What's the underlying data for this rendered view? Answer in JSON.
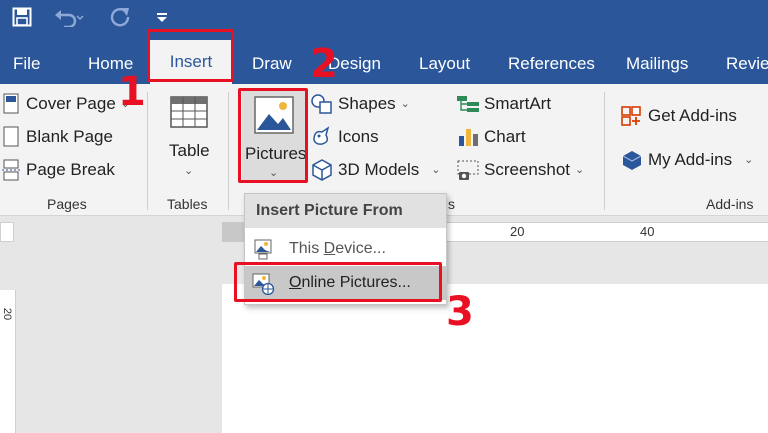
{
  "colors": {
    "title_bar": "#2b579a",
    "ribbon_bg": "#f3f3f3",
    "highlight": "#e81123",
    "menu_hover": "#c8c8c8"
  },
  "quick_access": {
    "save_icon": "save-icon",
    "undo_icon": "undo-icon",
    "redo_icon": "redo-icon",
    "customize_icon": "customize-qat-icon"
  },
  "tabs": {
    "file": "File",
    "home": "Home",
    "insert": "Insert",
    "draw": "Draw",
    "design": "Design",
    "layout": "Layout",
    "references": "References",
    "mailings": "Mailings",
    "review": "Revie"
  },
  "ribbon": {
    "pages": {
      "cover_page": "Cover Page",
      "blank_page": "Blank Page",
      "page_break": "Page Break",
      "group_label": "Pages"
    },
    "tables": {
      "table": "Table",
      "group_label": "Tables"
    },
    "illustrations": {
      "pictures": "Pictures",
      "shapes": "Shapes",
      "icons": "Icons",
      "models_3d": "3D Models",
      "smartart": "SmartArt",
      "chart": "Chart",
      "screenshot": "Screenshot",
      "group_label_fragment": "s"
    },
    "addins": {
      "get_addins": "Get Add-ins",
      "my_addins": "My Add-ins",
      "group_label": "Add-ins"
    }
  },
  "dropdown": {
    "header": "Insert Picture From",
    "items": [
      {
        "label": "This Device...",
        "accel": "D"
      },
      {
        "label": "Online Pictures...",
        "accel": "O"
      }
    ]
  },
  "ruler": {
    "labels": [
      "20",
      "40"
    ],
    "vertical_label": "20"
  },
  "steps": [
    "1",
    "2",
    "3"
  ]
}
